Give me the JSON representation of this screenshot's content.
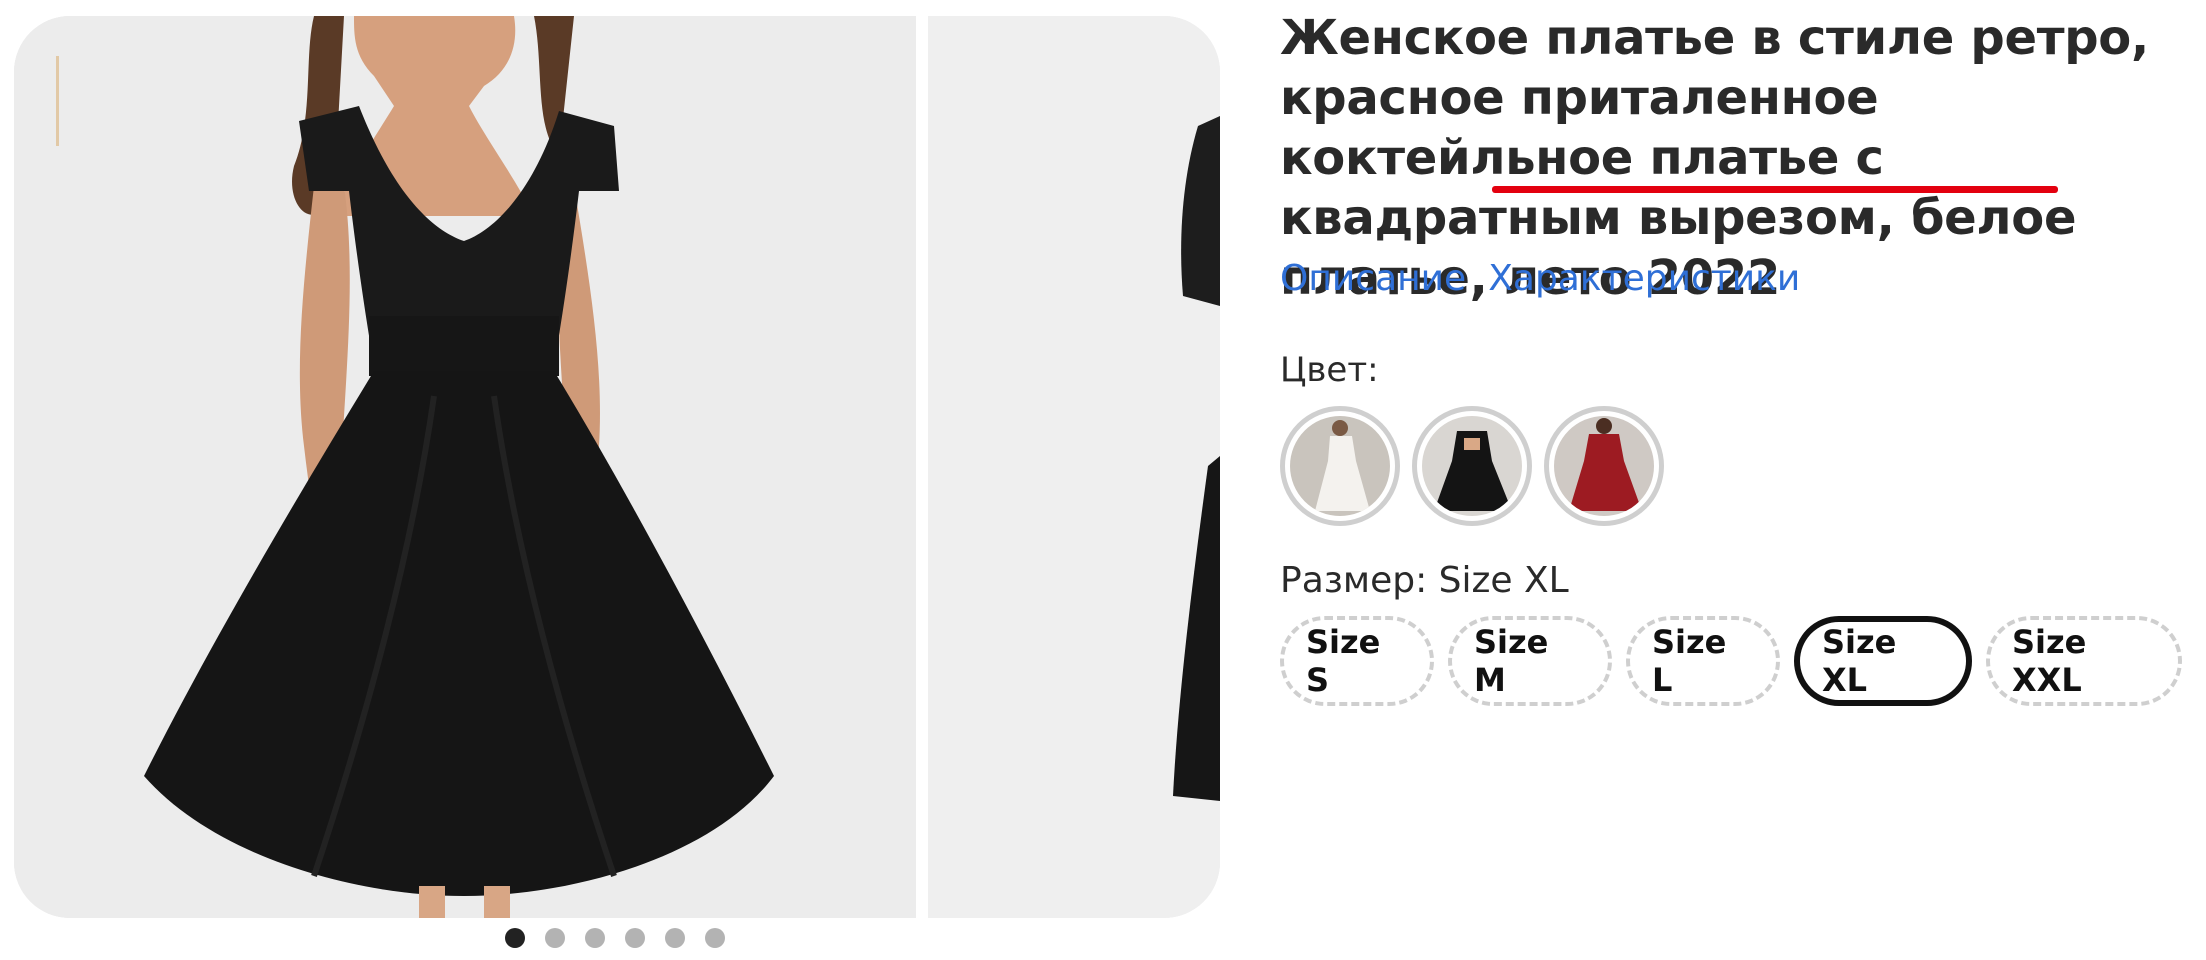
{
  "product": {
    "title_part1": "Женское платье в стиле ретро, красное приталенное коктейльное платье с ",
    "title_highlight": "квадратным вырезом,",
    "title_part2": " белое платье, лето 2022",
    "highlight_color": "#e3000f"
  },
  "links": {
    "description": "Описание",
    "characteristics": "Характеристики",
    "color": "#2f6fd6"
  },
  "color_section": {
    "label": "Цвет:",
    "swatches": [
      {
        "name": "white-dress-swatch",
        "color": "#e8e6e3"
      },
      {
        "name": "black-dress-swatch",
        "color": "#1c1c1c"
      },
      {
        "name": "red-dress-swatch",
        "color": "#9d1b22"
      }
    ]
  },
  "size_section": {
    "label": "Размер: Size XL",
    "sizes": [
      "Size S",
      "Size M",
      "Size L",
      "Size XL",
      "Size XXL"
    ],
    "selected": "Size XL"
  },
  "gallery": {
    "slide_count": 6,
    "active_index": 0
  }
}
